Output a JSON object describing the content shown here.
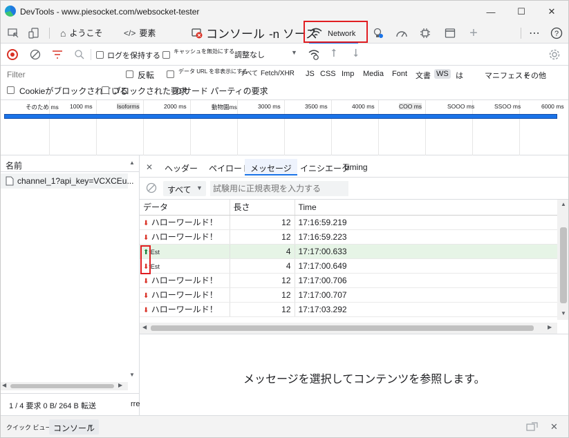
{
  "window": {
    "title": "DevTools - www.piesocket.com/websocket-tester",
    "controls": {
      "minimize": "—",
      "maximize": "☐",
      "close": "✕"
    }
  },
  "main_tabs": {
    "welcome": "ようこそ",
    "elements": "要素",
    "console": "コンソール",
    "sources": "-n ソース",
    "network": "Network"
  },
  "toolbar": {
    "preserve_log": "ログを保持する",
    "disable_cache": "キャッシュを無効にする",
    "throttle": "調整なし"
  },
  "filter": {
    "placeholder": "Filter",
    "invert": "反転",
    "hide_data_urls": "データ URL を非表示にする",
    "types": [
      "すべて",
      "Fetch/XHR",
      "JS",
      "CSS",
      "Imp",
      "Media",
      "Font",
      "文書",
      "WS",
      "は",
      "マニフェスト",
      "その他"
    ],
    "active_type": "WS",
    "blocked_cookies": "Cookieがブロックされている",
    "blocked_requests": "ブロックされた要求",
    "third_party": "0 サード パーティの要求"
  },
  "overview": {
    "ticks": [
      "そのため ms",
      "1000 ms",
      "Isoforms",
      "2000 ms",
      "動物園ms",
      "3000 ms",
      "3500 ms",
      "4000 ms",
      "COO ms",
      "SOOO ms",
      "SSOO ms",
      "6000 ms"
    ]
  },
  "left_panel": {
    "header": "名前",
    "request": "channel_1?api_key=VCXCEu...",
    "status": "1 / 4 要求 0 B/ 264 B 転送",
    "status_tail": "rre"
  },
  "detail_tabs": {
    "close": "✕",
    "headers": "ヘッダー",
    "payload": "ペイロード",
    "messages": "メッセージ",
    "initiator": "イニシエータ",
    "timing": "Timing"
  },
  "messages_filter": {
    "select": "すべて",
    "placeholder": "試験用に正規表現を入力する"
  },
  "messages_table": {
    "columns": [
      "データ",
      "長さ",
      "Time"
    ],
    "rows": [
      {
        "dir": "down",
        "data": "ハローワールド！",
        "len": "12",
        "time": "17:16:59.219",
        "small": false
      },
      {
        "dir": "down",
        "data": "ハローワールド！",
        "len": "12",
        "time": "17:16:59.223",
        "small": false
      },
      {
        "dir": "up",
        "data": "tEst",
        "len": "4",
        "time": "17:17:00.633",
        "small": true
      },
      {
        "dir": "down",
        "data": "tEst",
        "len": "4",
        "time": "17:17:00.649",
        "small": true
      },
      {
        "dir": "down",
        "data": "ハローワールド！",
        "len": "12",
        "time": "17:17:00.706",
        "small": false
      },
      {
        "dir": "down",
        "data": "ハローワールド！",
        "len": "12",
        "time": "17:17:00.707",
        "small": false
      },
      {
        "dir": "down",
        "data": "ハローワールド！",
        "len": "12",
        "time": "17:17:03.292",
        "small": false
      }
    ]
  },
  "empty_message": "メッセージを選択してコンテンツを参照します。",
  "drawer": {
    "label": "クイック ビュー:",
    "select": "コンソール"
  },
  "colors": {
    "accent_blue": "#1a73e8",
    "highlight_red": "#e11d21",
    "selected_row": "#e6f4e6",
    "arrow_up": "#188038",
    "arrow_down": "#d93025"
  }
}
